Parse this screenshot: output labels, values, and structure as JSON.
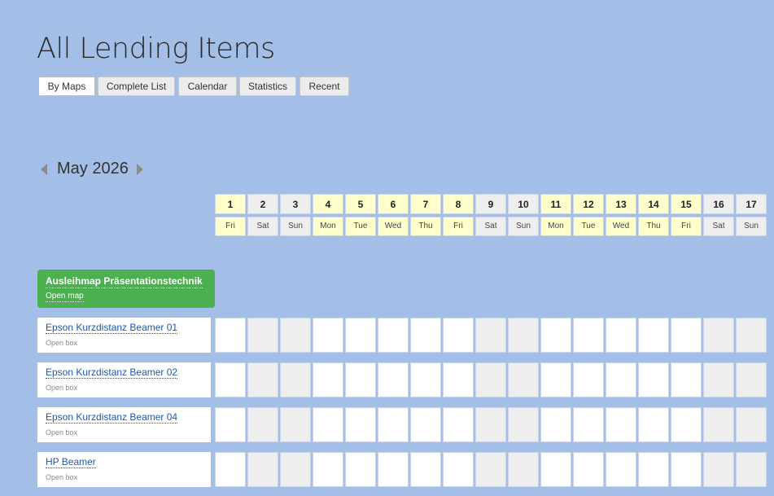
{
  "page": {
    "title": "All Lending Items"
  },
  "tabs": [
    {
      "label": "By Maps",
      "active": true
    },
    {
      "label": "Complete List",
      "active": false
    },
    {
      "label": "Calendar",
      "active": false
    },
    {
      "label": "Statistics",
      "active": false
    },
    {
      "label": "Recent",
      "active": false
    }
  ],
  "calendar": {
    "month_label": "May 2026",
    "days": [
      {
        "num": "1",
        "name": "Fri",
        "weekend": false
      },
      {
        "num": "2",
        "name": "Sat",
        "weekend": true
      },
      {
        "num": "3",
        "name": "Sun",
        "weekend": true
      },
      {
        "num": "4",
        "name": "Mon",
        "weekend": false
      },
      {
        "num": "5",
        "name": "Tue",
        "weekend": false
      },
      {
        "num": "6",
        "name": "Wed",
        "weekend": false
      },
      {
        "num": "7",
        "name": "Thu",
        "weekend": false
      },
      {
        "num": "8",
        "name": "Fri",
        "weekend": false
      },
      {
        "num": "9",
        "name": "Sat",
        "weekend": true
      },
      {
        "num": "10",
        "name": "Sun",
        "weekend": true
      },
      {
        "num": "11",
        "name": "Mon",
        "weekend": false
      },
      {
        "num": "12",
        "name": "Tue",
        "weekend": false
      },
      {
        "num": "13",
        "name": "Wed",
        "weekend": false
      },
      {
        "num": "14",
        "name": "Thu",
        "weekend": false
      },
      {
        "num": "15",
        "name": "Fri",
        "weekend": false
      },
      {
        "num": "16",
        "name": "Sat",
        "weekend": true
      },
      {
        "num": "17",
        "name": "Sun",
        "weekend": true
      }
    ]
  },
  "group": {
    "title": "Ausleihmap Präsentationstechnik",
    "subtitle": "Open map"
  },
  "items": [
    {
      "name": "Epson Kurzdistanz Beamer 01",
      "subtitle": "Open box"
    },
    {
      "name": "Epson Kurzdistanz Beamer 02",
      "subtitle": "Open box"
    },
    {
      "name": "Epson Kurzdistanz Beamer 04",
      "subtitle": "Open box"
    },
    {
      "name": "HP Beamer",
      "subtitle": "Open box"
    }
  ],
  "colors": {
    "background": "#a3bfe7",
    "group_header": "#4caf50",
    "weekday_header": "#ffffcc",
    "weekend": "#eeeeee",
    "link": "#1f56b0"
  }
}
